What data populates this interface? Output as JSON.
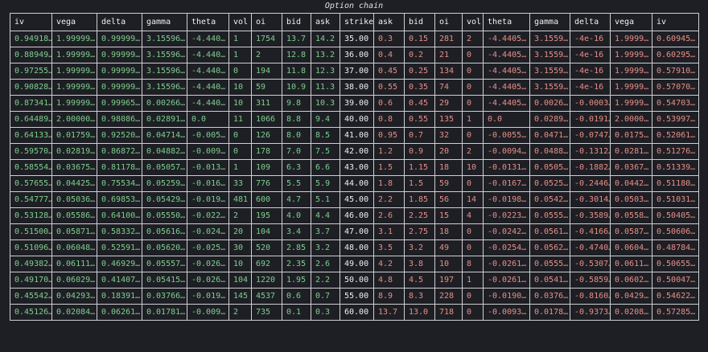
{
  "title": "Option chain",
  "columns": [
    "iv",
    "vega",
    "delta",
    "gamma",
    "theta",
    "vol",
    "oi",
    "bid",
    "ask",
    "strike",
    "ask",
    "bid",
    "oi",
    "vol",
    "theta",
    "gamma",
    "delta",
    "vega",
    "iv"
  ],
  "colors": {
    "background": "#1e1f25",
    "call_text": "#7fcf8f",
    "put_text": "#e88f86",
    "grid": "#cfcfcf"
  },
  "rows": [
    [
      "0.94918…",
      "1.99999…",
      "0.99999…",
      "3.15596…",
      "-4.440…",
      "1",
      "1754",
      "13.7",
      "14.2",
      "35.00",
      "0.3",
      "0.15",
      "281",
      "2",
      "-4.4405…",
      "3.1559…",
      "-4e-16",
      "1.9999…",
      "0.60945…"
    ],
    [
      "0.88949…",
      "1.99999…",
      "0.99999…",
      "3.15596…",
      "-4.440…",
      "1",
      "2",
      "12.8",
      "13.2",
      "36.00",
      "0.4",
      "0.2",
      "21",
      "0",
      "-4.4405…",
      "3.1559…",
      "-4e-16",
      "1.9999…",
      "0.60295…"
    ],
    [
      "0.97255…",
      "1.99999…",
      "0.99999…",
      "3.15596…",
      "-4.440…",
      "0",
      "194",
      "11.8",
      "12.3",
      "37.00",
      "0.45",
      "0.25",
      "134",
      "0",
      "-4.4405…",
      "3.1559…",
      "-4e-16",
      "1.9999…",
      "0.57910…"
    ],
    [
      "0.90828…",
      "1.99999…",
      "0.99999…",
      "3.15596…",
      "-4.440…",
      "10",
      "59",
      "10.9",
      "11.3",
      "38.00",
      "0.55",
      "0.35",
      "74",
      "0",
      "-4.4405…",
      "3.1559…",
      "-4e-16",
      "1.9999…",
      "0.57070…"
    ],
    [
      "0.87341…",
      "1.99999…",
      "0.99965…",
      "0.00266…",
      "-4.440…",
      "10",
      "311",
      "9.8",
      "10.3",
      "39.00",
      "0.6",
      "0.45",
      "29",
      "0",
      "-4.4405…",
      "0.0026…",
      "-0.0003…",
      "1.9999…",
      "0.54703…"
    ],
    [
      "0.64489…",
      "2.00000…",
      "0.98086…",
      "0.02891…",
      "0.0",
      "11",
      "1066",
      "8.8",
      "9.4",
      "40.00",
      "0.8",
      "0.55",
      "135",
      "1",
      "0.0",
      "0.0289…",
      "-0.0191…",
      "2.0000…",
      "0.53997…"
    ],
    [
      "0.64133…",
      "0.01759…",
      "0.92520…",
      "0.04714…",
      "-0.005…",
      "0",
      "126",
      "8.0",
      "8.5",
      "41.00",
      "0.95",
      "0.7",
      "32",
      "0",
      "-0.0055…",
      "0.0471…",
      "-0.0747…",
      "0.0175…",
      "0.52061…"
    ],
    [
      "0.59570…",
      "0.02819…",
      "0.86872…",
      "0.04882…",
      "-0.009…",
      "0",
      "178",
      "7.0",
      "7.5",
      "42.00",
      "1.2",
      "0.9",
      "20",
      "2",
      "-0.0094…",
      "0.0488…",
      "-0.1312…",
      "0.0281…",
      "0.51276…"
    ],
    [
      "0.58554…",
      "0.03675…",
      "0.81178…",
      "0.05057…",
      "-0.013…",
      "1",
      "109",
      "6.3",
      "6.6",
      "43.00",
      "1.5",
      "1.15",
      "18",
      "10",
      "-0.0131…",
      "0.0505…",
      "-0.1882…",
      "0.0367…",
      "0.51339…"
    ],
    [
      "0.57655…",
      "0.04425…",
      "0.75534…",
      "0.05259…",
      "-0.016…",
      "33",
      "776",
      "5.5",
      "5.9",
      "44.00",
      "1.8",
      "1.5",
      "59",
      "0",
      "-0.0167…",
      "0.0525…",
      "-0.2446…",
      "0.0442…",
      "0.51180…"
    ],
    [
      "0.54777…",
      "0.05036…",
      "0.69853…",
      "0.05429…",
      "-0.019…",
      "481",
      "600",
      "4.7",
      "5.1",
      "45.00",
      "2.2",
      "1.85",
      "56",
      "14",
      "-0.0198…",
      "0.0542…",
      "-0.3014…",
      "0.0503…",
      "0.51031…"
    ],
    [
      "0.53128…",
      "0.05586…",
      "0.64100…",
      "0.05550…",
      "-0.022…",
      "2",
      "195",
      "4.0",
      "4.4",
      "46.00",
      "2.6",
      "2.25",
      "15",
      "4",
      "-0.0223…",
      "0.0555…",
      "-0.3589…",
      "0.0558…",
      "0.50405…"
    ],
    [
      "0.51500…",
      "0.05871…",
      "0.58332…",
      "0.05616…",
      "-0.024…",
      "20",
      "104",
      "3.4",
      "3.7",
      "47.00",
      "3.1",
      "2.75",
      "18",
      "0",
      "-0.0242…",
      "0.0561…",
      "-0.4166…",
      "0.0587…",
      "0.50606…"
    ],
    [
      "0.51096…",
      "0.06048…",
      "0.52591…",
      "0.05620…",
      "-0.025…",
      "30",
      "520",
      "2.85",
      "3.2",
      "48.00",
      "3.5",
      "3.2",
      "49",
      "0",
      "-0.0254…",
      "0.0562…",
      "-0.4740…",
      "0.0604…",
      "0.48784…"
    ],
    [
      "0.49382…",
      "0.06111…",
      "0.46929…",
      "0.05557…",
      "-0.026…",
      "10",
      "692",
      "2.35",
      "2.6",
      "49.00",
      "4.2",
      "3.8",
      "10",
      "8",
      "-0.0261…",
      "0.0555…",
      "-0.5307…",
      "0.0611…",
      "0.50655…"
    ],
    [
      "0.49170…",
      "0.06029…",
      "0.41407…",
      "0.05415…",
      "-0.026…",
      "104",
      "1220",
      "1.95",
      "2.2",
      "50.00",
      "4.8",
      "4.5",
      "197",
      "1",
      "-0.0261…",
      "0.0541…",
      "-0.5859…",
      "0.0602…",
      "0.50047…"
    ],
    [
      "0.45542…",
      "0.04293…",
      "0.18391…",
      "0.03766…",
      "-0.019…",
      "145",
      "4537",
      "0.6",
      "0.7",
      "55.00",
      "8.9",
      "8.3",
      "228",
      "0",
      "-0.0190…",
      "0.0376…",
      "-0.8160…",
      "0.0429…",
      "0.54622…"
    ],
    [
      "0.45126…",
      "0.02084…",
      "0.06261…",
      "0.01781…",
      "-0.009…",
      "2",
      "735",
      "0.1",
      "0.3",
      "60.00",
      "13.7",
      "13.0",
      "718",
      "0",
      "-0.0093…",
      "0.0178…",
      "-0.9373…",
      "0.0208…",
      "0.57285…"
    ]
  ]
}
